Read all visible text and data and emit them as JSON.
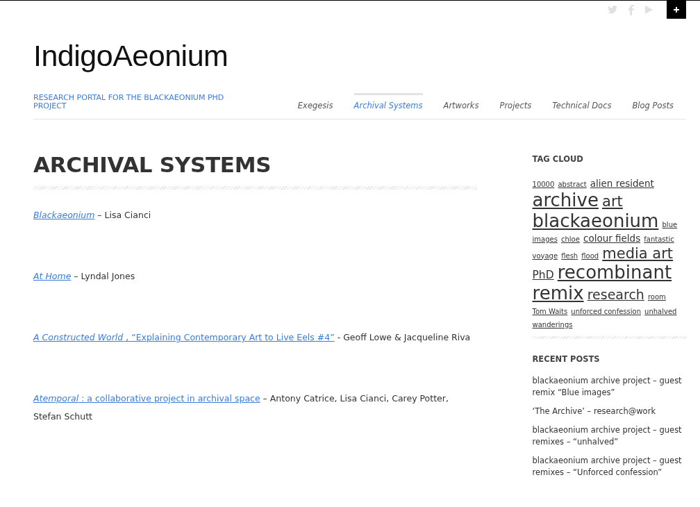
{
  "site": {
    "title": "IndigoAeonium",
    "tagline": "RESEARCH PORTAL FOR THE BLACKAEONIUM PHD PROJECT"
  },
  "nav": [
    {
      "label": "Exegesis",
      "selected": false
    },
    {
      "label": "Archival Systems",
      "selected": true
    },
    {
      "label": "Artworks",
      "selected": false
    },
    {
      "label": "Projects",
      "selected": false
    },
    {
      "label": "Technical Docs",
      "selected": false
    },
    {
      "label": "Blog Posts",
      "selected": false
    }
  ],
  "page": {
    "heading": "ARCHIVAL SYSTEMS",
    "entries": [
      {
        "title": "Blackaeonium",
        "credit": "– Lisa Cianci"
      },
      {
        "title": "At Home",
        "credit": "– Lyndal Jones"
      },
      {
        "title": "A Constructed World",
        "rest": " , “Explaining Contemporary Art to Live Eels #4”",
        "credit": "-  Geoff Lowe & Jacqueline Riva"
      },
      {
        "title": "Atemporal",
        "rest": " :  a collaborative project in archival space",
        "credit": "– Antony Catrice, Lisa Cianci, Carey Potter, Stefan Schutt"
      }
    ]
  },
  "sidebar": {
    "tag_cloud": {
      "title": "TAG CLOUD",
      "tags": [
        {
          "label": "10000",
          "kind": "s"
        },
        {
          "label": "abstract",
          "kind": "s"
        },
        {
          "label": "alien resident",
          "kind": "m"
        },
        {
          "label": "archive",
          "kind": "xl"
        },
        {
          "label": "art",
          "kind": "l"
        },
        {
          "label": "blackaeonium",
          "kind": "xl"
        },
        {
          "label": "blue",
          "kind": "s"
        },
        {
          "label": "images",
          "kind": "s"
        },
        {
          "label": "chloe",
          "kind": "s"
        },
        {
          "label": "colour fields",
          "kind": "m"
        },
        {
          "label": "fantastic",
          "kind": "s"
        },
        {
          "label": "voyage",
          "kind": "s"
        },
        {
          "label": "flesh",
          "kind": "s"
        },
        {
          "label": "flood",
          "kind": "s"
        },
        {
          "label": "media art",
          "kind": "l"
        },
        {
          "label": "PhD",
          "kind": "ml"
        },
        {
          "label": "recombinant",
          "kind": "xl"
        },
        {
          "label": "remix",
          "kind": "xl"
        },
        {
          "label": "research",
          "kind": "lm"
        },
        {
          "label": "room",
          "kind": "s"
        },
        {
          "label": "Tom Waits",
          "kind": "s"
        },
        {
          "label": "unforced confession",
          "kind": "s"
        },
        {
          "label": "unhalved",
          "kind": "s"
        },
        {
          "label": "wanderings",
          "kind": "s"
        }
      ]
    },
    "recent_posts": {
      "title": "RECENT POSTS",
      "posts": [
        "blackaeonium archive project – guest remix “Blue images”",
        "‘The Archive’ – research@work",
        "blackaeonium archive project – guest remixes – “unhalved”",
        "blackaeonium archive project – guest remixes – “Unforced confession”"
      ]
    }
  }
}
